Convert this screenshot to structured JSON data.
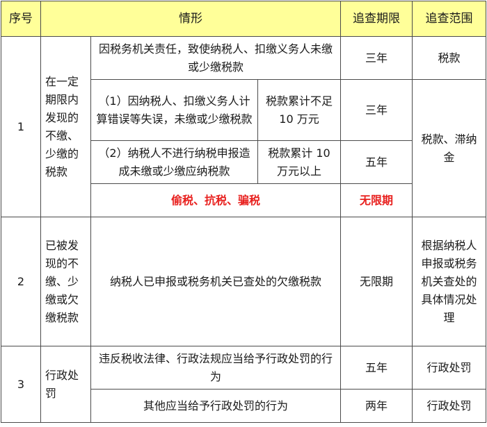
{
  "table": {
    "headers": [
      "序号",
      "情形",
      "追查期限",
      "追查范围"
    ],
    "group1": {
      "seq": "1",
      "category": "在一定期限内发现的不缴、少缴的税款",
      "rows": [
        {
          "situation": "因税务机关责任，致使纳税人、扣缴义务人未缴或少缴税款",
          "period": "三年",
          "scope": "税款"
        },
        {
          "situation": "（1）因纳税人、扣缴义务人计算错误等失误，未缴或少缴税款",
          "condition": "税款累计不足 10 万元",
          "period": "三年",
          "scope": "税款、滞纳金"
        },
        {
          "situation": "（2）纳税人不进行纳税申报造成未缴或少缴应纳税款",
          "condition": "税款累计 10 万元以上",
          "period": "五年"
        },
        {
          "situation": "偷税、抗税、骗税",
          "period": "无限期"
        }
      ]
    },
    "group2": {
      "seq": "2",
      "category": "已被发现的不缴、少缴或欠缴税款",
      "situation": "纳税人已申报或税务机关已查处的欠缴税款",
      "period": "无限期",
      "scope": "根据纳税人申报或税务机关查处的具体情况处理"
    },
    "group3": {
      "seq": "3",
      "category": "行政处罚",
      "rows": [
        {
          "situation": "违反税收法律、行政法规应当给予行政处罚的行为",
          "period": "五年",
          "scope": "行政处罚"
        },
        {
          "situation": "其他应当给予行政处罚的行为",
          "period": "两年",
          "scope": "行政处罚"
        }
      ]
    },
    "colors": {
      "header_bg": "#ffff99",
      "highlight_text": "#e8201e",
      "border": "#4a4a4a"
    }
  }
}
